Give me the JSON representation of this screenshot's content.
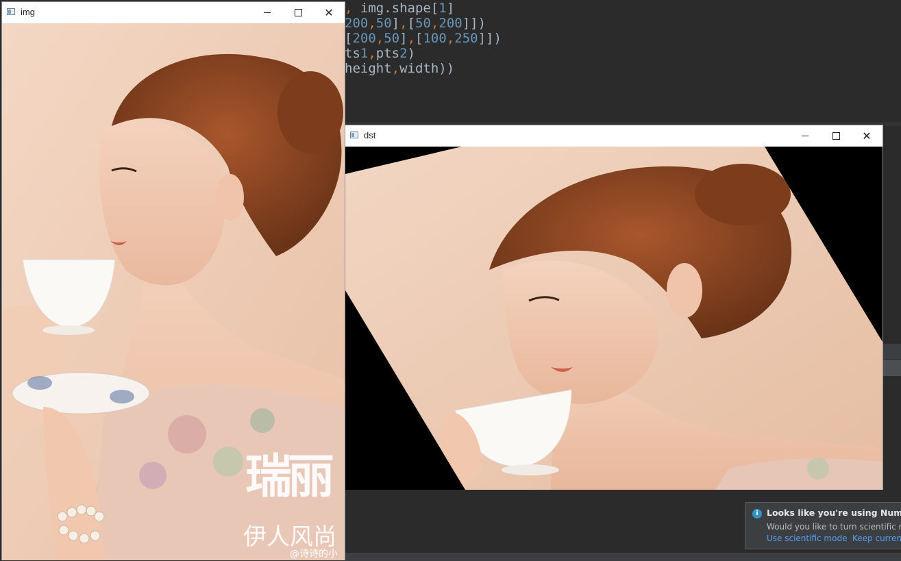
{
  "editor": {
    "code_lines": [
      {
        "prefix": "",
        "text": ", img.shape[1]"
      },
      {
        "text": "200,50],[50,200]])"
      },
      {
        "text": "[200,50],[100,250]])"
      },
      {
        "text": "ts1,pts2)"
      },
      {
        "text": "height,width))"
      }
    ]
  },
  "windows": {
    "img": {
      "title": "img",
      "overlay_text_1": "瑞丽",
      "overlay_text_2": "伊人风尚",
      "overlay_text_3": "@诗诗的小"
    },
    "dst": {
      "title": "dst"
    }
  },
  "notification": {
    "title": "Looks like you're using NumPy",
    "body": "Would you like to turn scientific m",
    "action_primary": "Use scientific mode",
    "action_secondary": "Keep curren"
  },
  "colors": {
    "ide_background": "#2b2b2b",
    "code_text": "#a9b7c6",
    "code_number": "#6897bb",
    "code_separator": "#cc7832",
    "link": "#589df6"
  }
}
